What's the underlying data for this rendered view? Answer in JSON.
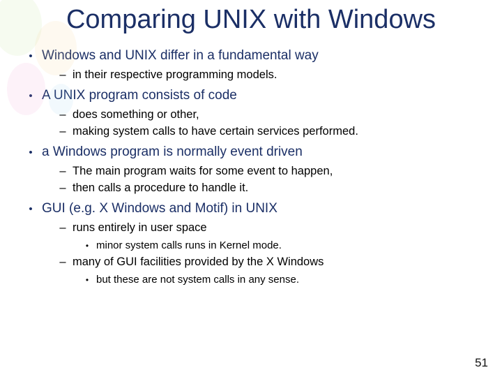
{
  "title": "Comparing UNIX with Windows",
  "page_number": "51",
  "bullets": [
    {
      "text": "Windows and UNIX differ in a fundamental way",
      "sub": [
        {
          "text": "in their respective programming models."
        }
      ]
    },
    {
      "text": "A UNIX program consists of code",
      "sub": [
        {
          "text": "does something or other,"
        },
        {
          "text": "making system calls to have certain services performed."
        }
      ]
    },
    {
      "text": "a Windows program is normally event driven",
      "sub": [
        {
          "text": "The main program waits for some event to happen,"
        },
        {
          "text": "then calls a procedure to handle it."
        }
      ]
    },
    {
      "text": "GUI (e.g. X Windows and Motif) in UNIX",
      "sub": [
        {
          "text": "runs entirely in user space",
          "sub3": [
            {
              "text": "minor system calls runs in Kernel mode."
            }
          ]
        },
        {
          "text": "many of GUI facilities provided by the X Windows",
          "sub3": [
            {
              "text": "but these are not system calls in any sense."
            }
          ]
        }
      ]
    }
  ]
}
